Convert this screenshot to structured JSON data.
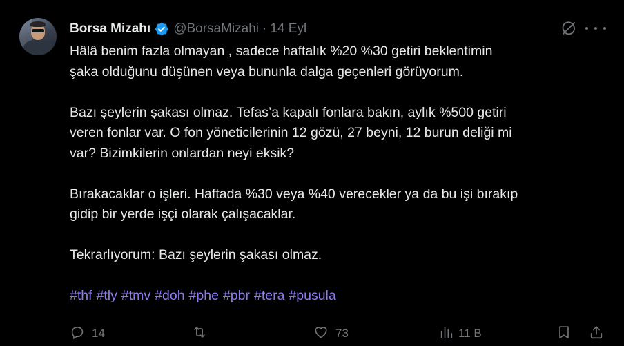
{
  "author": {
    "name": "Borsa Mizahı",
    "handle": "@BorsaMizahi",
    "separator": "·",
    "date": "14 Eyl",
    "verified_color": "#1d9bf0"
  },
  "tweet": {
    "paragraphs": [
      [
        "Hâlâ benim fazla olmayan , sadece haftalık %20 %30 getiri beklentimin",
        "şaka olduğunu düşünen veya bununla dalga geçenleri görüyorum."
      ],
      [
        "Bazı şeylerin şakası olmaz. Tefas’a kapalı fonlara bakın, aylık %500 getiri",
        "veren fonlar var. O fon yöneticilerinin 12 gözü, 27 beyni, 12 burun deliği mi",
        "var? Bizimkilerin onlardan neyi eksik?"
      ],
      [
        "Bırakacaklar o işleri. Haftada %30 veya %40 verecekler ya da bu işi bırakıp",
        "gidip bir yerde işçi olarak çalışacaklar."
      ],
      [
        "Tekrarlıyorum: Bazı şeylerin şakası olmaz."
      ]
    ],
    "hashtags": [
      "#thf",
      "#tly",
      "#tmv",
      "#doh",
      "#phe",
      "#pbr",
      "#tera",
      "#pusula"
    ],
    "hashtag_color": "#8b7cf6"
  },
  "actions": {
    "replies": "14",
    "reposts": "",
    "likes": "73",
    "views": "11 B"
  },
  "icons": [
    "verified-badge-icon",
    "grok-icon",
    "more-icon",
    "reply-icon",
    "repost-icon",
    "like-icon",
    "views-icon",
    "bookmark-icon",
    "share-icon"
  ]
}
